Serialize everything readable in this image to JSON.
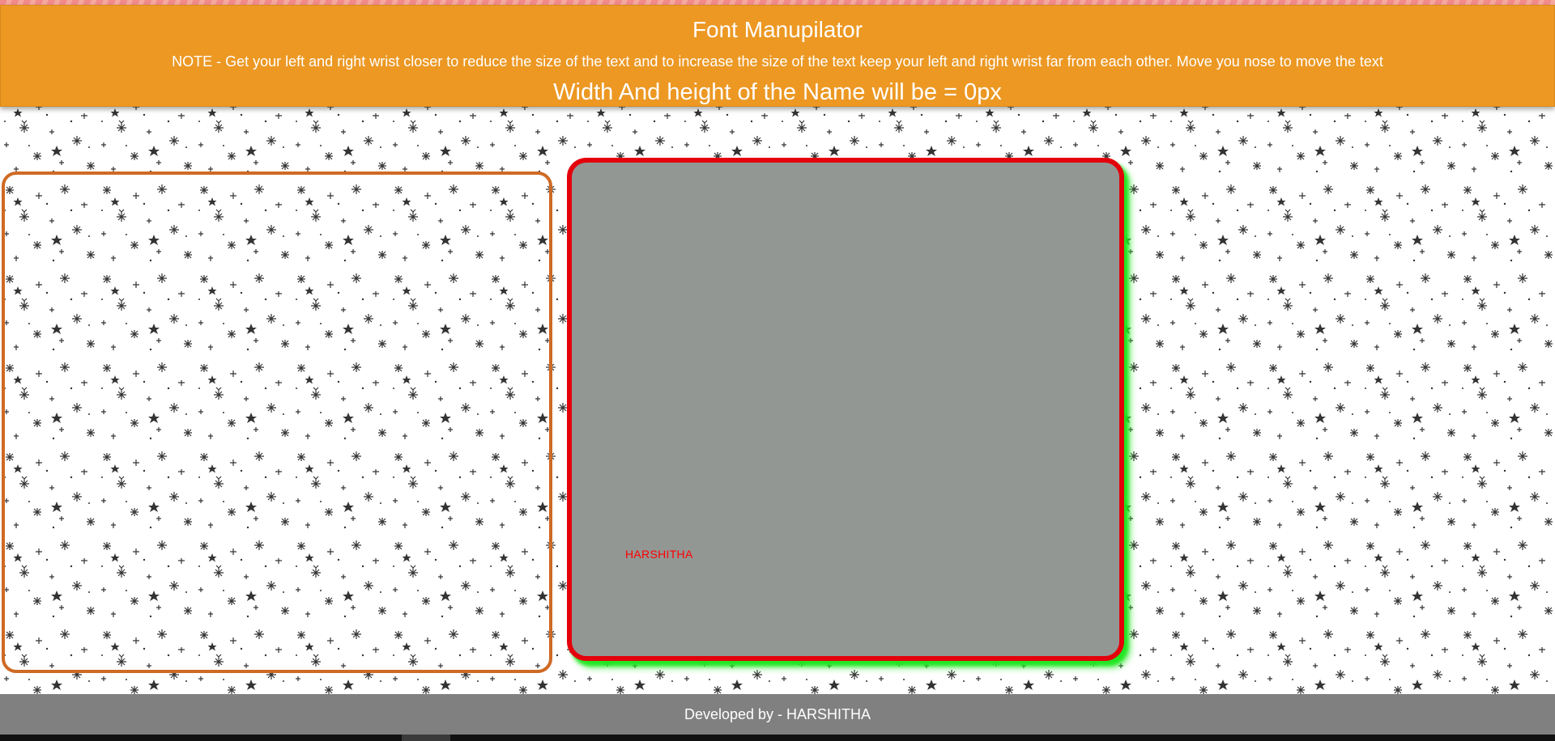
{
  "header": {
    "title": "Font Manupilator",
    "note": "NOTE - Get your left and right wrist closer to reduce the size of the text and to increase the size of the text keep your left and right wrist far from each other. Move you nose to move the text",
    "size_readout": "Width And height of the Name will be = 0px"
  },
  "canvas": {
    "name_text": "HARSHITHA",
    "text_color": "#ff0000",
    "background_color": "#939794",
    "border_color": "#e3000b",
    "shadow_color": "#22e622"
  },
  "video_panel": {
    "border_color": "#cf6a24"
  },
  "footer": {
    "credit": "Developed by - HARSHITHA"
  },
  "colors": {
    "header_bg": "#ec9823",
    "footer_bg": "#808080"
  }
}
